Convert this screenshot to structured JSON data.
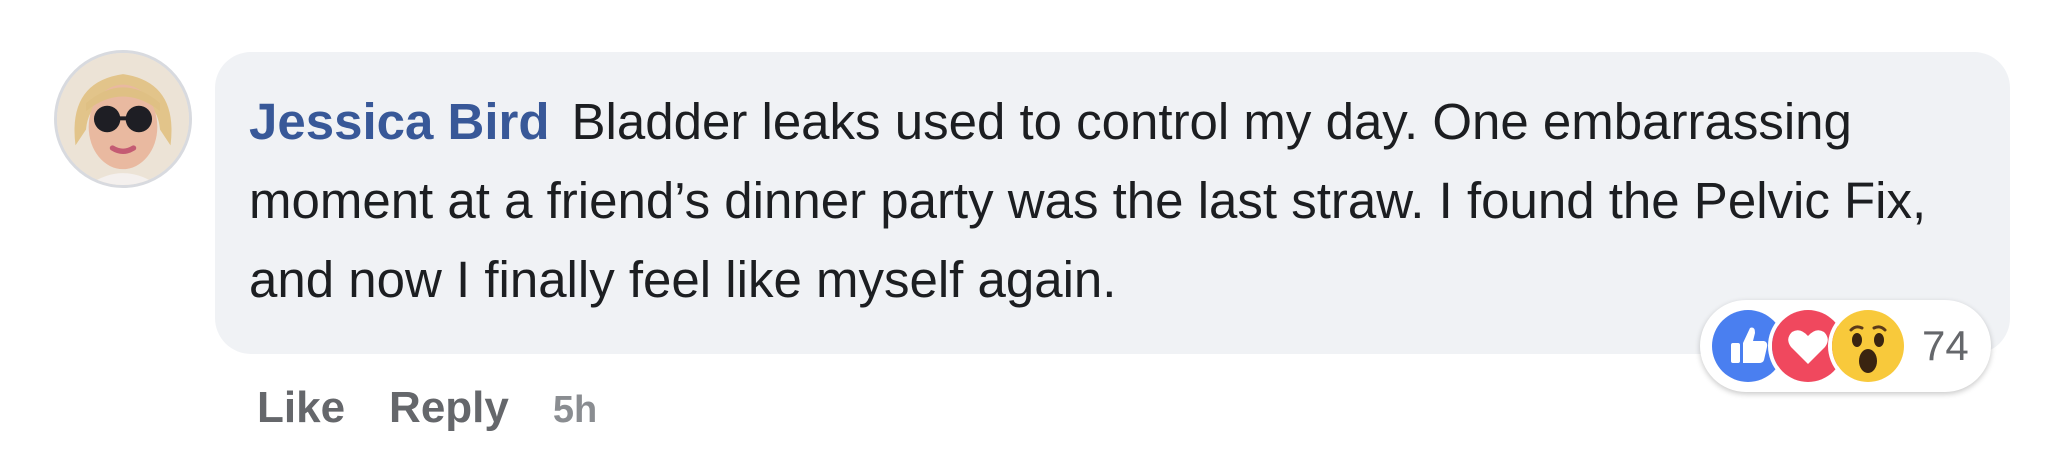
{
  "comment": {
    "author": "Jessica Bird",
    "text": "Bladder leaks used to control my day. One embarrassing moment at a friend’s dinner party was the last straw. I found the Pelvic Fix, and now I finally feel like myself again.",
    "avatar_icon": "user-avatar-photo"
  },
  "reactions": {
    "icons": [
      "like-icon",
      "love-icon",
      "wow-icon"
    ],
    "count": "74",
    "colors": {
      "like": "#4a7ff0",
      "love": "#f0485e",
      "wow": "#f8c93b"
    }
  },
  "actions": {
    "like_label": "Like",
    "reply_label": "Reply",
    "timestamp": "5h"
  },
  "colors": {
    "author_link": "#385898",
    "bubble_bg": "#f0f2f5",
    "meta_text": "#65676b"
  }
}
